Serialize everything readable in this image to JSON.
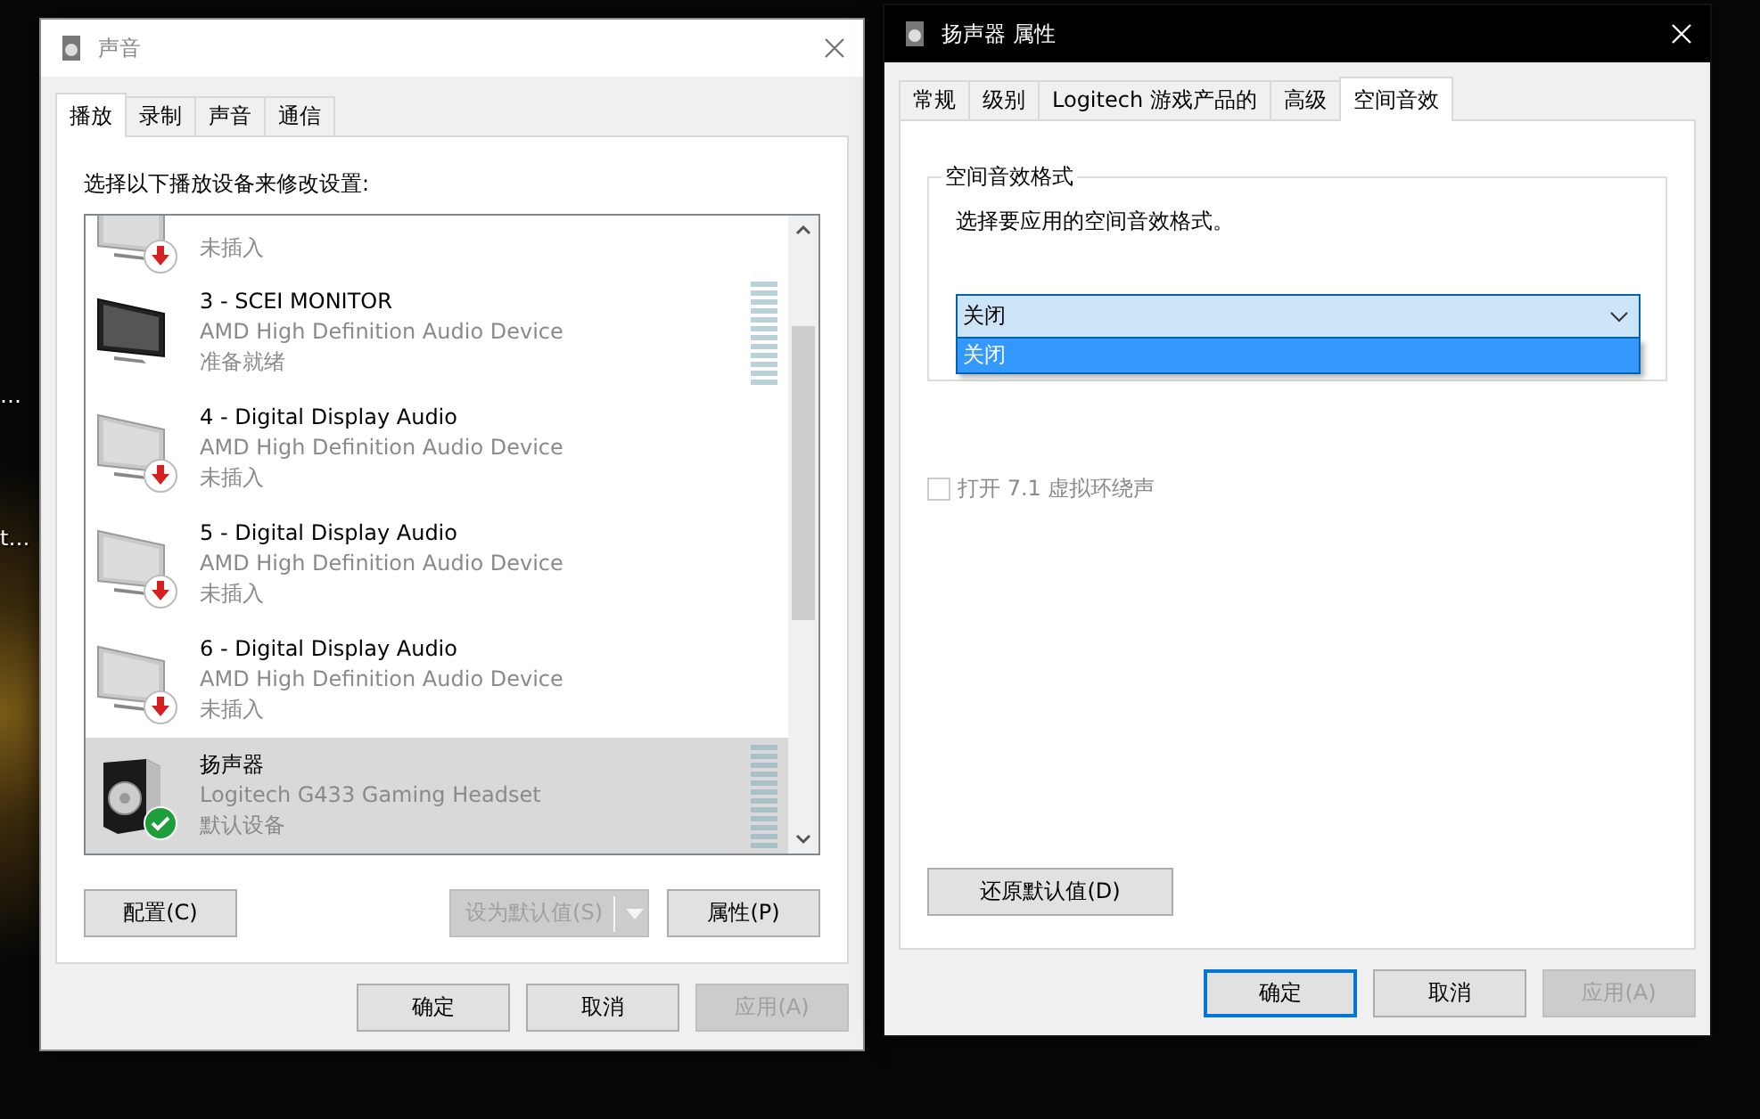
{
  "desktop": {
    "labels": [
      "…",
      "t…"
    ]
  },
  "sound_window": {
    "title": "声音",
    "active": false,
    "tabs": [
      {
        "label": "播放",
        "selected": true
      },
      {
        "label": "录制",
        "selected": false
      },
      {
        "label": "声音",
        "selected": false
      },
      {
        "label": "通信",
        "selected": false
      }
    ],
    "instruction": "选择以下播放设备来修改设置:",
    "devices": [
      {
        "kind": "monitor",
        "status": "未插入",
        "unplugged": true,
        "is_default": false,
        "selected": false
      },
      {
        "kind": "monitor",
        "name": "3 - SCEI MONITOR",
        "description": "AMD High Definition Audio Device",
        "status": "准备就绪",
        "unplugged": false,
        "is_default": false,
        "selected": false
      },
      {
        "kind": "monitor",
        "name": "4 - Digital Display Audio",
        "description": "AMD High Definition Audio Device",
        "status": "未插入",
        "unplugged": true,
        "is_default": false,
        "selected": false
      },
      {
        "kind": "monitor",
        "name": "5 - Digital Display Audio",
        "description": "AMD High Definition Audio Device",
        "status": "未插入",
        "unplugged": true,
        "is_default": false,
        "selected": false
      },
      {
        "kind": "monitor",
        "name": "6 - Digital Display Audio",
        "description": "AMD High Definition Audio Device",
        "status": "未插入",
        "unplugged": true,
        "is_default": false,
        "selected": false
      },
      {
        "kind": "speaker",
        "name": "扬声器",
        "description": "Logitech G433 Gaming Headset",
        "status": "默认设备",
        "unplugged": false,
        "is_default": true,
        "selected": true
      }
    ],
    "actions": [
      {
        "label": "配置(C)",
        "disabled": false
      },
      {
        "label": "设为默认值(S)",
        "disabled": true,
        "kind": "split"
      },
      {
        "label": "属性(P)",
        "disabled": false
      }
    ],
    "footer": [
      {
        "label": "确定",
        "disabled": false,
        "focused": false
      },
      {
        "label": "取消",
        "disabled": false,
        "focused": false
      },
      {
        "label": "应用(A)",
        "disabled": true,
        "focused": false
      }
    ]
  },
  "properties_window": {
    "title": "扬声器 属性",
    "active": true,
    "tabs": [
      {
        "label": "常规",
        "selected": false
      },
      {
        "label": "级别",
        "selected": false
      },
      {
        "label": "Logitech 游戏产品的",
        "selected": false
      },
      {
        "label": "高级",
        "selected": false
      },
      {
        "label": "空间音效",
        "selected": true
      }
    ],
    "group": {
      "title": "空间音效格式",
      "hint": "选择要应用的空间音效格式。",
      "combo": {
        "value": "关闭",
        "expanded": true,
        "options": [
          {
            "label": "关闭",
            "selected": true
          }
        ]
      }
    },
    "surround": {
      "label": "打开 7.1 虚拟环绕声",
      "checked": false,
      "disabled": true
    },
    "reset_button": {
      "label": "还原默认值(D)"
    },
    "footer": [
      {
        "label": "确定",
        "disabled": false,
        "focused": true
      },
      {
        "label": "取消",
        "disabled": false,
        "focused": false
      },
      {
        "label": "应用(A)",
        "disabled": true,
        "focused": false
      }
    ]
  }
}
